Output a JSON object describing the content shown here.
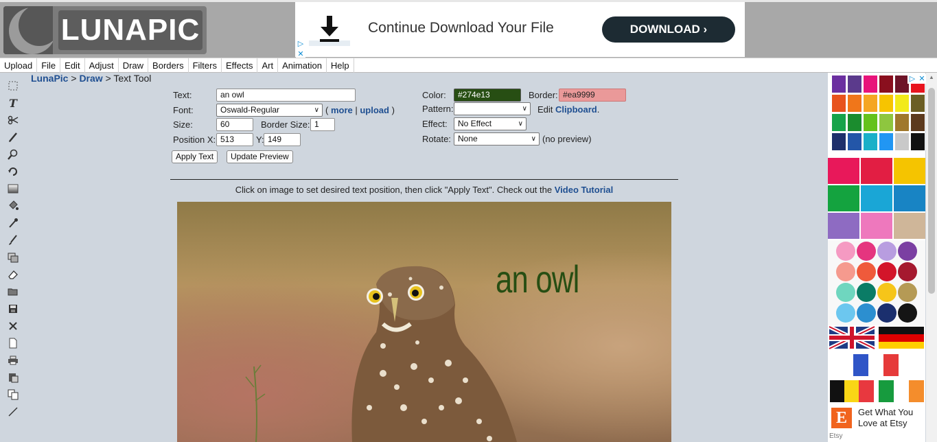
{
  "logo": {
    "text": "LUNAPIC"
  },
  "top_ad": {
    "headline": "Continue Download Your File",
    "button": "DOWNLOAD",
    "button_icon": "chevron-right-icon",
    "icon": "download-icon"
  },
  "menu": [
    "Upload",
    "File",
    "Edit",
    "Adjust",
    "Draw",
    "Borders",
    "Filters",
    "Effects",
    "Art",
    "Animation",
    "Help"
  ],
  "breadcrumb": {
    "home": "LunaPic",
    "section": "Draw",
    "current": "Text Tool",
    "sep": ">"
  },
  "form": {
    "text_label": "Text:",
    "text_value": "an owl",
    "font_label": "Font:",
    "font_value": "Oswald-Regular",
    "more": "more",
    "upload": "upload",
    "size_label": "Size:",
    "size_value": "60",
    "border_size_label": "Border Size:",
    "border_size_value": "1",
    "posx_label": "Position X:",
    "posx_value": "513",
    "posy_label": "Y:",
    "posy_value": "149",
    "apply": "Apply Text",
    "update": "Update Preview",
    "color_label": "Color:",
    "color_value": "#274e13",
    "border_label": "Border:",
    "border_value": "#ea9999",
    "pattern_label": "Pattern:",
    "pattern_value": "",
    "edit": "Edit",
    "clipboard": "Clipboard",
    "effect_label": "Effect:",
    "effect_value": "No Effect",
    "rotate_label": "Rotate:",
    "rotate_value": "None",
    "no_preview": "(no preview)"
  },
  "instructions": {
    "text": "Click on image to set desired text position, then click \"Apply Text\". Check out the",
    "link": "Video Tutorial"
  },
  "canvas": {
    "overlay_text": "an owl"
  },
  "side_ad": {
    "swatches": [
      "#6b2fa0",
      "#5b3a8c",
      "#e8137a",
      "#8a0f1e",
      "#6d1428",
      "#e8141e",
      "#e8531e",
      "#f0761a",
      "#f5a623",
      "#f7c400",
      "#f2ea1a",
      "#6b5e24",
      "#17a34a",
      "#1b8c2e",
      "#65c21b",
      "#8ec63f",
      "#a0782c",
      "#5c3a1e",
      "#1e2f6b",
      "#2356a8",
      "#1ab0c8",
      "#2196f3",
      "#c9c9c9",
      "#111111"
    ],
    "etsy_text": "Get What You Love at Etsy",
    "etsy_brand": "Etsy"
  },
  "colors": {
    "topbar": "#a8a8a8",
    "link": "#1f4f91",
    "text_color": "#274e13",
    "border_color": "#ea9999"
  }
}
